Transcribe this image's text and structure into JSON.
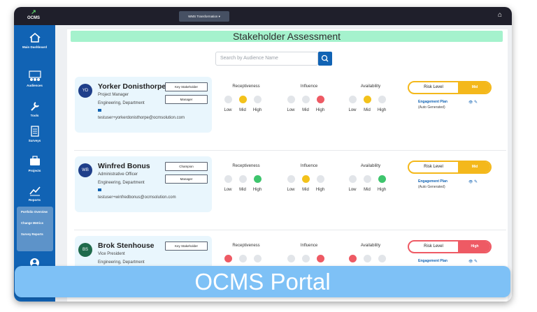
{
  "app": {
    "logo_text": "OCMS"
  },
  "topbar": {
    "project_select": "WMS Transformation"
  },
  "sidebar": {
    "items": [
      {
        "label": "Main Dashboard",
        "icon": "home-icon"
      },
      {
        "label": "Audiences",
        "icon": "audiences-icon"
      },
      {
        "label": "Tools",
        "icon": "wrench-icon"
      },
      {
        "label": "Surveys",
        "icon": "surveys-icon"
      },
      {
        "label": "Projects",
        "icon": "projects-icon"
      },
      {
        "label": "Reports",
        "icon": "reports-icon"
      }
    ],
    "sub_items": [
      "Portfolio Overview",
      "Change Metrics",
      "Survey Reports"
    ]
  },
  "page": {
    "title": "Stakeholder Assessment",
    "search_placeholder": "Search by Audience Name"
  },
  "labels": {
    "receptiveness": "Receptiveness",
    "influence": "Influence",
    "availability": "Availability",
    "low": "Low",
    "mid": "Mid",
    "high": "High",
    "risk_level": "Risk Level",
    "engagement_plan": "Engagement Plan",
    "auto_generated": "(Auto Generated)"
  },
  "stakeholders": [
    {
      "initials": "YD",
      "name": "Yorker Donisthorpe",
      "title": "Project Manager",
      "department": "Engineering, Department",
      "email": "testuser+yorkerdonisthorpe@ocmsolution.com",
      "tags": [
        "Key Stakeholder",
        "Manager"
      ],
      "receptiveness": "Mid",
      "influence": "High",
      "availability": "Mid",
      "risk": "Mid"
    },
    {
      "initials": "WB",
      "name": "Winfred Bonus",
      "title": "Administrative Officer",
      "department": "Engineering, Department",
      "email": "testuser+winfredbonus@ocmsolution.com",
      "tags": [
        "Champion",
        "Manager"
      ],
      "receptiveness": "High",
      "influence": "Mid",
      "availability": "High",
      "risk": "Mid"
    },
    {
      "initials": "BS",
      "name": "Brok Stenhouse",
      "title": "Vice President",
      "department": "Engineering, Department",
      "email": "",
      "tags": [
        "Key Stakeholder"
      ],
      "receptiveness": "Low",
      "influence": "High",
      "availability": "Low",
      "risk": "High"
    }
  ],
  "banner": {
    "text": "OCMS Portal"
  },
  "colors": {
    "sidebar": "#1163b4",
    "title_bg": "#a5f2cd",
    "mid": "#f4b81b",
    "high_risk": "#ee5a64",
    "positive": "#3ec56d"
  }
}
